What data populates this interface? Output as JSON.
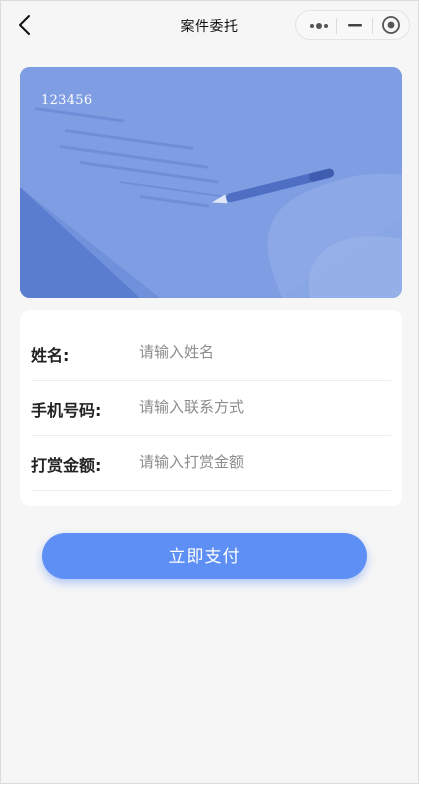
{
  "navbar": {
    "title": "案件委托",
    "icons": {
      "back": "chevron-left-icon",
      "more": "more-dots-icon",
      "minimize": "minimize-icon",
      "close": "target-circle-icon"
    }
  },
  "banner": {
    "text": "123456",
    "image": "document-signing-pen-photo"
  },
  "form": {
    "fields": [
      {
        "label": "姓名:",
        "placeholder": "请输入姓名",
        "value": ""
      },
      {
        "label": "手机号码:",
        "placeholder": "请输入联系方式",
        "value": ""
      },
      {
        "label": "打赏金额:",
        "placeholder": "请输入打赏金额",
        "value": ""
      }
    ]
  },
  "actions": {
    "pay_label": "立即支付"
  },
  "colors": {
    "background": "#f6f6f6",
    "banner_tint": "#6f91dc",
    "primary": "#5e8ff5",
    "card": "#ffffff"
  }
}
